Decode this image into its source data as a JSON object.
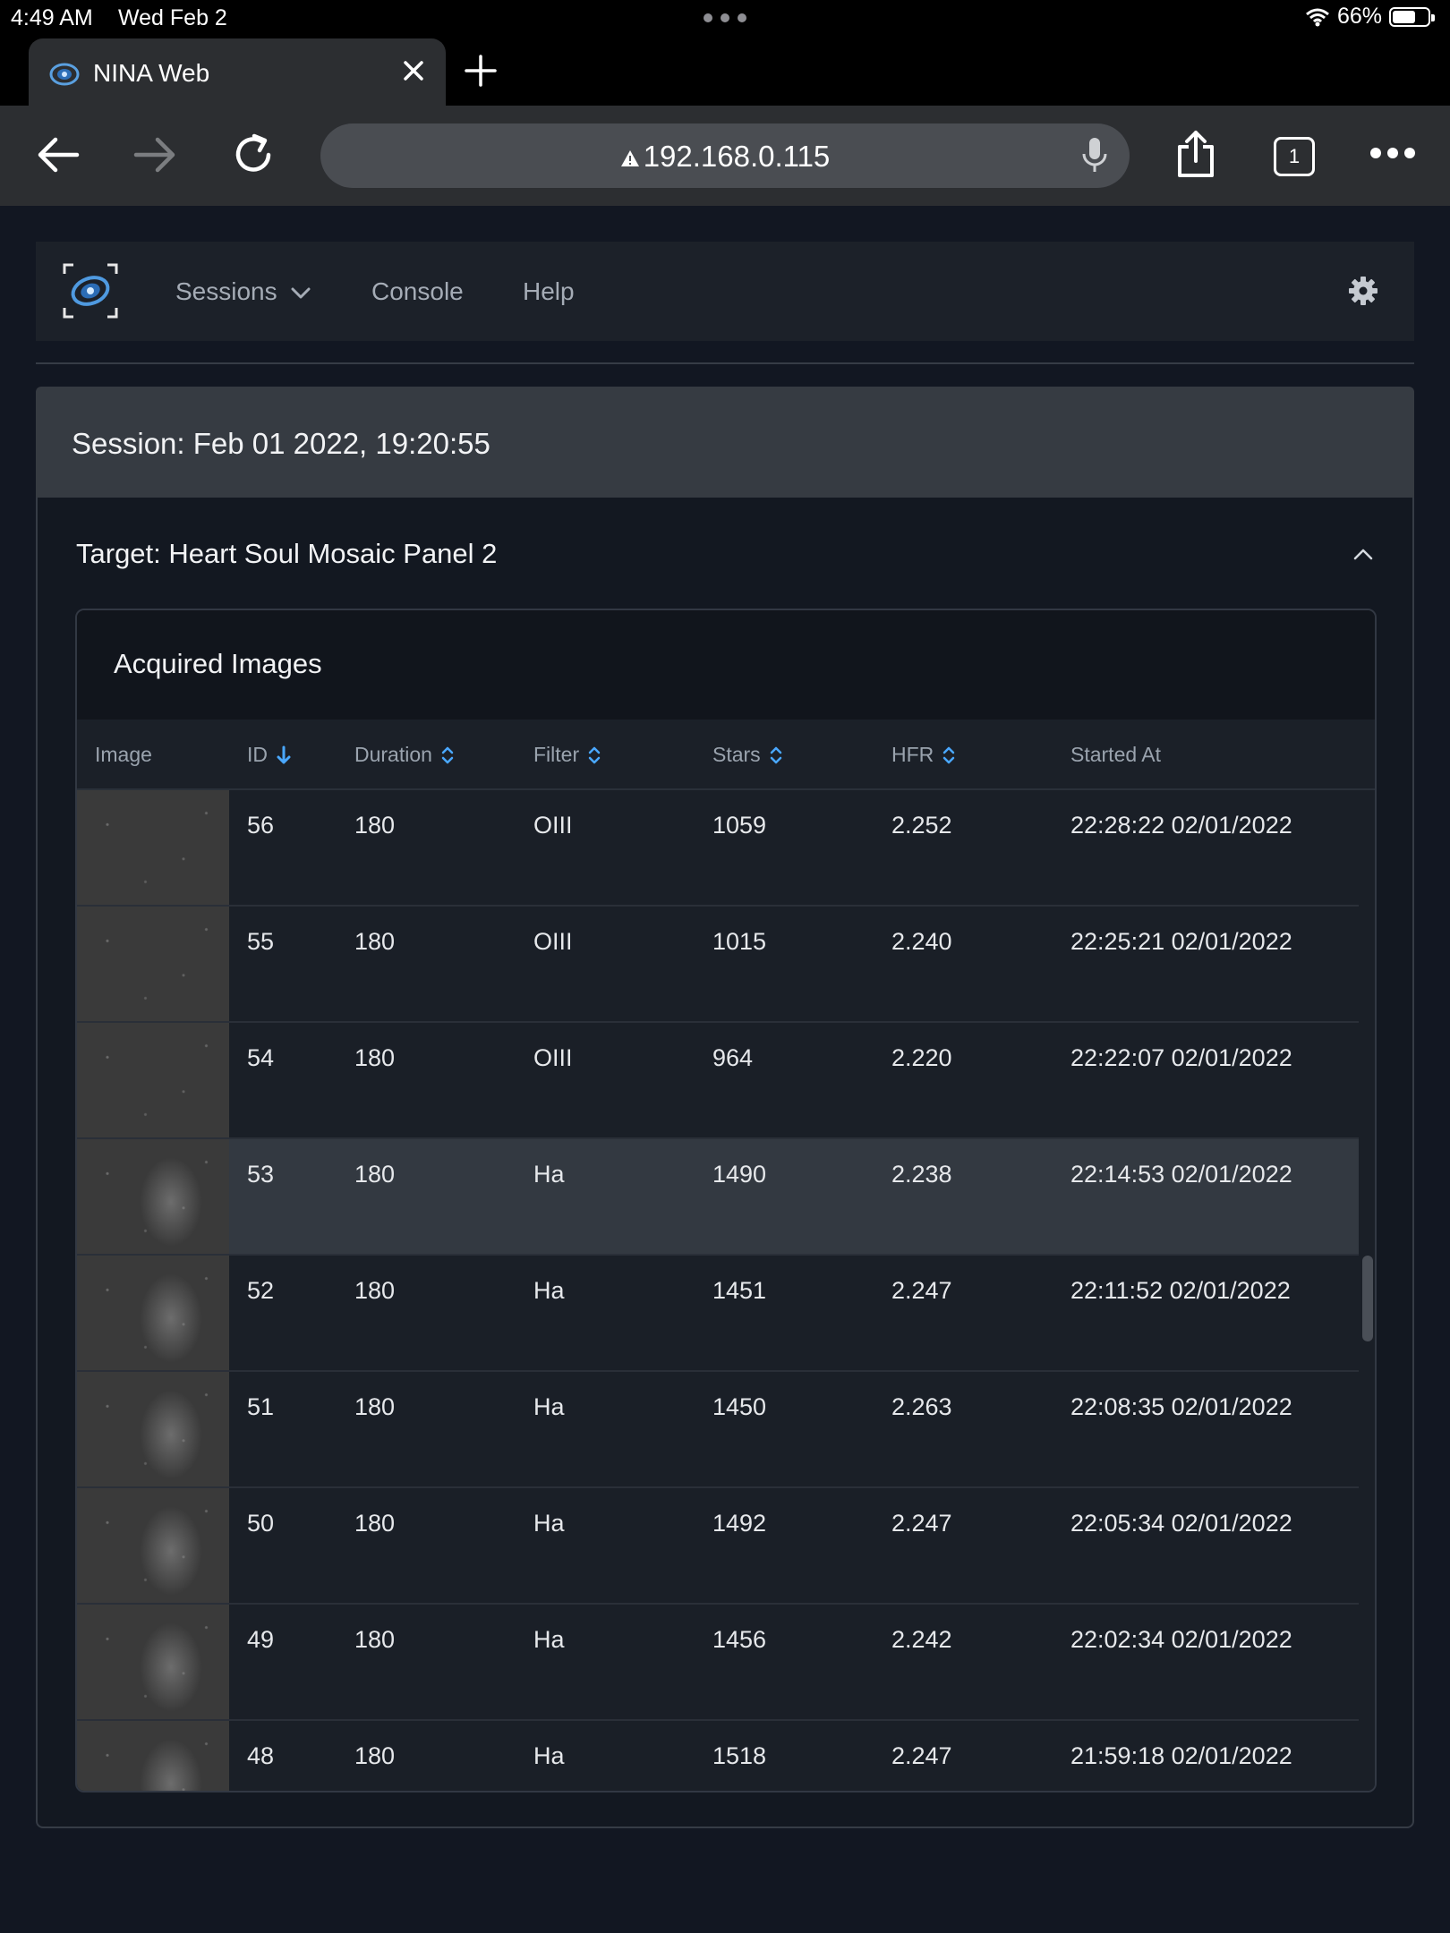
{
  "status_bar": {
    "time": "4:49 AM",
    "date": "Wed Feb 2",
    "battery": "66%",
    "battery_level": 0.66
  },
  "browser": {
    "tab_title": "NINA Web",
    "url": "192.168.0.115",
    "tab_count": "1"
  },
  "nav": {
    "items": [
      {
        "label": "Sessions"
      },
      {
        "label": "Console"
      },
      {
        "label": "Help"
      }
    ]
  },
  "session": {
    "label": "Session: Feb 01 2022, 19:20:55"
  },
  "target": {
    "label": "Target: Heart Soul Mosaic Panel 2"
  },
  "acquired": {
    "title": "Acquired Images",
    "columns": [
      "Image",
      "ID",
      "Duration",
      "Filter",
      "Stars",
      "HFR",
      "Started At"
    ],
    "rows": [
      {
        "id": "56",
        "duration": "180",
        "filter": "OIII",
        "stars": "1059",
        "hfr": "2.252",
        "started": "22:28:22 02/01/2022"
      },
      {
        "id": "55",
        "duration": "180",
        "filter": "OIII",
        "stars": "1015",
        "hfr": "2.240",
        "started": "22:25:21 02/01/2022"
      },
      {
        "id": "54",
        "duration": "180",
        "filter": "OIII",
        "stars": "964",
        "hfr": "2.220",
        "started": "22:22:07 02/01/2022"
      },
      {
        "id": "53",
        "duration": "180",
        "filter": "Ha",
        "stars": "1490",
        "hfr": "2.238",
        "started": "22:14:53 02/01/2022"
      },
      {
        "id": "52",
        "duration": "180",
        "filter": "Ha",
        "stars": "1451",
        "hfr": "2.247",
        "started": "22:11:52 02/01/2022"
      },
      {
        "id": "51",
        "duration": "180",
        "filter": "Ha",
        "stars": "1450",
        "hfr": "2.263",
        "started": "22:08:35 02/01/2022"
      },
      {
        "id": "50",
        "duration": "180",
        "filter": "Ha",
        "stars": "1492",
        "hfr": "2.247",
        "started": "22:05:34 02/01/2022"
      },
      {
        "id": "49",
        "duration": "180",
        "filter": "Ha",
        "stars": "1456",
        "hfr": "2.242",
        "started": "22:02:34 02/01/2022"
      },
      {
        "id": "48",
        "duration": "180",
        "filter": "Ha",
        "stars": "1518",
        "hfr": "2.247",
        "started": "21:59:18 02/01/2022"
      }
    ],
    "selected_id": "53"
  },
  "colors": {
    "accent": "#4aa8ff",
    "background": "#121722"
  }
}
